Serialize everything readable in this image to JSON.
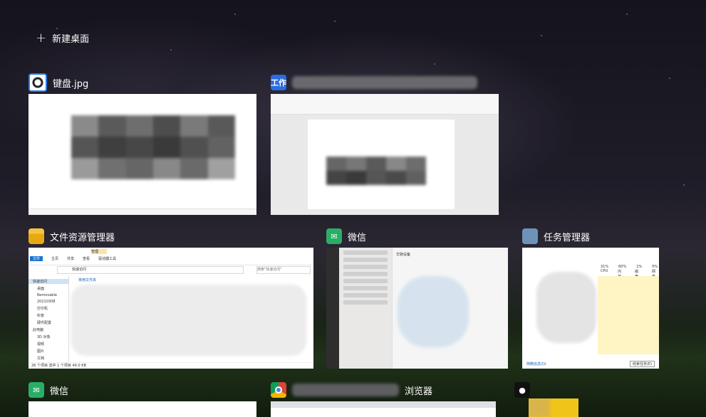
{
  "new_desktop": {
    "label": "新建桌面",
    "icon": "plus-icon"
  },
  "windows": [
    {
      "title": "键盘.jpg",
      "icon": "image-viewer-icon"
    },
    {
      "title": "工作",
      "icon": "wps-writer-icon"
    },
    {
      "title": "文件资源管理器",
      "icon": "folder-icon",
      "thumb": {
        "ribbon_tabs": [
          "文件",
          "主页",
          "共享",
          "查看"
        ],
        "manage_tab": "管理",
        "manage_sub": "驱动器工具",
        "address": "快速访问",
        "search_placeholder": "搜索\"快速访问\"",
        "nav_items": [
          "快速访问",
          "桌面",
          "Removable",
          "20210308",
          "打印机",
          "科普",
          "硬件配置",
          "此电脑",
          "3D 对象",
          "视频",
          "图片",
          "文档"
        ],
        "section": "常用文件夹",
        "status": "26 个项目  选中 1 个项目 49.0 KB"
      }
    },
    {
      "title": "微信",
      "icon": "wechat-icon",
      "thumb": {
        "header": "华驰设备"
      }
    },
    {
      "title": "任务管理器",
      "icon": "task-manager-icon",
      "thumb": {
        "cols": [
          "31%",
          "60%",
          "1%",
          "0%"
        ],
        "col_labels": [
          "CPU",
          "内存",
          "磁盘",
          "网络"
        ],
        "link": "简略信息(D)",
        "button": "结束任务(E)"
      }
    },
    {
      "title": "微信",
      "icon": "wechat-icon"
    },
    {
      "title": "浏览器",
      "icon": "chrome-icon"
    },
    {
      "title": "",
      "icon": "qq-icon"
    }
  ]
}
